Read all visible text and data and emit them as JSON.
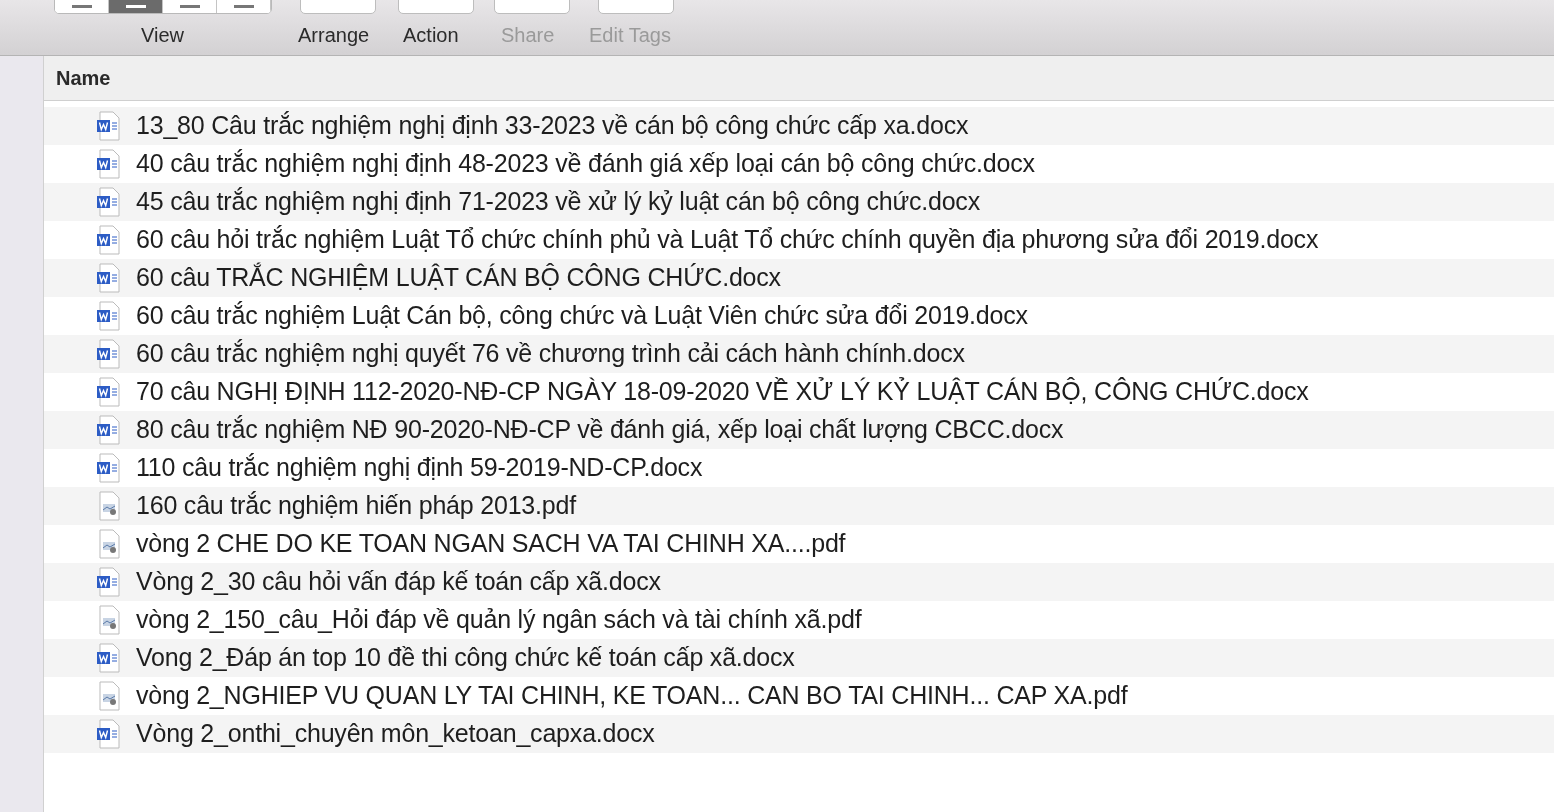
{
  "toolbar": {
    "view": {
      "label": "View",
      "modes": [
        {
          "selected": false
        },
        {
          "selected": true
        },
        {
          "selected": false
        },
        {
          "selected": false
        }
      ]
    },
    "buttons": [
      {
        "label": "Arrange",
        "disabled": false
      },
      {
        "label": "Action",
        "disabled": false
      },
      {
        "label": "Share",
        "disabled": true
      },
      {
        "label": "Edit Tags",
        "disabled": true
      }
    ]
  },
  "list": {
    "columns": [
      "Name"
    ],
    "files": [
      {
        "kind": "word",
        "name": "13_80 Câu trắc nghiệm nghị định 33-2023 về cán bộ công chức cấp xa.docx"
      },
      {
        "kind": "word",
        "name": "40 câu trắc nghiệm nghị định 48-2023 về đánh giá xếp loại cán bộ công chức.docx"
      },
      {
        "kind": "word",
        "name": "45 câu trắc nghiệm nghị định 71-2023 về xử lý kỷ luật cán bộ công chức.docx"
      },
      {
        "kind": "word",
        "name": "60 câu hỏi trắc nghiệm Luật Tổ chức chính phủ và Luật Tổ chức chính quyền địa phương sửa đổi 2019.docx"
      },
      {
        "kind": "word",
        "name": "60 câu TRẮC NGHIỆM LUẬT CÁN BỘ CÔNG CHỨC.docx"
      },
      {
        "kind": "word",
        "name": "60 câu trắc nghiệm Luật Cán bộ, công chức và Luật Viên chức sửa đổi 2019.docx"
      },
      {
        "kind": "word",
        "name": "60 câu trắc nghiệm nghị quyết 76 về chương trình cải cách hành chính.docx"
      },
      {
        "kind": "word",
        "name": "70 câu NGHỊ ĐỊNH 112-2020-NĐ-CP NGÀY 18-09-2020 VỀ XỬ LÝ KỶ LUẬT CÁN BỘ, CÔNG CHỨC.docx"
      },
      {
        "kind": "word",
        "name": "80 câu trắc nghiệm NĐ 90-2020-NĐ-CP về đánh giá, xếp loại chất lượng CBCC.docx"
      },
      {
        "kind": "word",
        "name": "110 câu trắc nghiệm nghị định 59-2019-ND-CP.docx"
      },
      {
        "kind": "pdf",
        "name": "160 câu trắc nghiệm hiến pháp 2013.pdf"
      },
      {
        "kind": "pdf",
        "name": "vòng 2 CHE DO KE TOAN NGAN SACH VA TAI CHINH XA....pdf"
      },
      {
        "kind": "word",
        "name": "Vòng 2_30 câu hỏi vấn đáp kế toán cấp xã.docx"
      },
      {
        "kind": "pdf",
        "name": "vòng 2_150_câu_Hỏi đáp về quản lý ngân sách và tài chính xã.pdf"
      },
      {
        "kind": "word",
        "name": "Vong 2_Đáp án top 10 đề thi công chức kế toán cấp xã.docx"
      },
      {
        "kind": "pdf",
        "name": "vòng 2_NGHIEP VU QUAN LY TAI CHINH, KE TOAN... CAN BO TAI CHINH... CAP XA.pdf"
      },
      {
        "kind": "word",
        "name": "Vòng 2_onthi_chuyên môn_ketoan_capxa.docx"
      }
    ]
  }
}
